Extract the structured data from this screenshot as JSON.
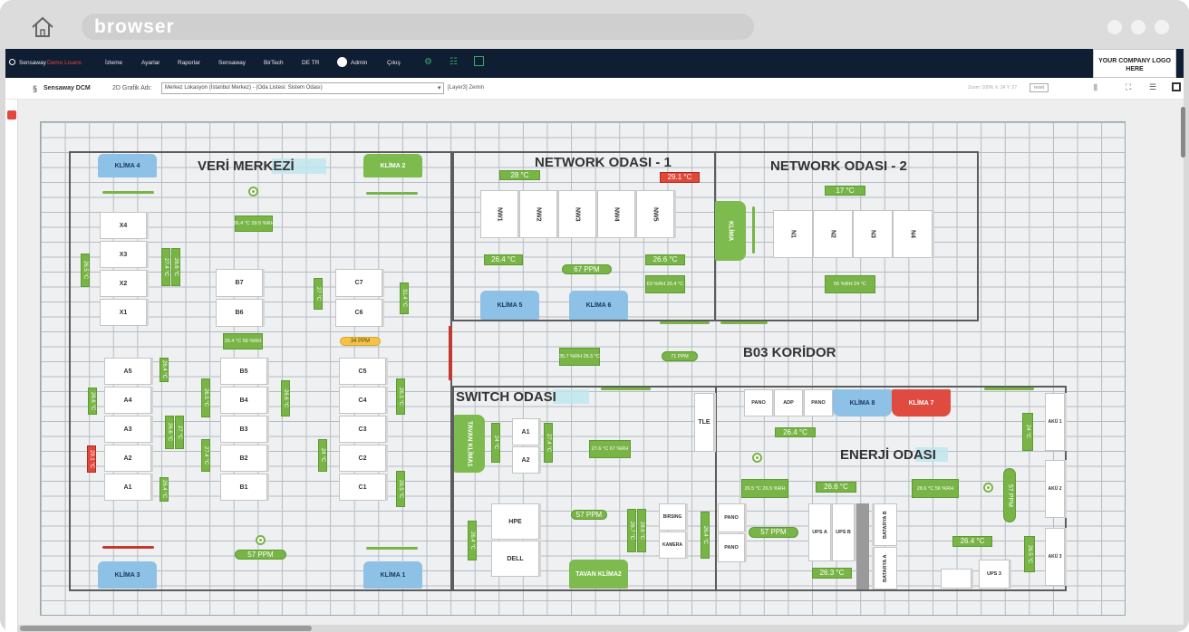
{
  "browser": {
    "url_text": "browser"
  },
  "nav": {
    "brand": "Sensaway",
    "brand_sub": "Demo Lisans",
    "items": [
      "İzleme",
      "Ayarlar",
      "Raporlar",
      "Sensaway",
      "BirTech",
      "DE TR"
    ],
    "user": "Admin",
    "logout": "Çıkış",
    "logo": "YOUR COMPANY LOGO HERE"
  },
  "subbar": {
    "app": "Sensaway DCM",
    "label": "2D Grafik Adı:",
    "location": "Merkez Lokasyon (İstanbul Merkez) - (Oda Listesi: Sistem Odası)",
    "layer": "[Layer3] Zemin",
    "zoom": "Zoom: 100% X: 24 Y: 27",
    "reset": "reset"
  },
  "rooms": {
    "veri": "VERİ MERKEZİ",
    "net1": "NETWORK ODASI - 1",
    "net2": "NETWORK ODASI - 2",
    "koridor": "B03 KORİDOR",
    "switch": "SWITCH ODASI",
    "enerji": "ENERJİ ODASI"
  },
  "racks": {
    "x4": "X4",
    "x3": "X3",
    "x2": "X2",
    "x1": "X1",
    "b7": "B7",
    "b6": "B6",
    "c7": "C7",
    "c6": "C6",
    "a5": "A5",
    "a4": "A4",
    "a3": "A3",
    "a2": "A2",
    "a1": "A1",
    "b5": "B5",
    "b4": "B4",
    "b3": "B3",
    "b2": "B2",
    "b1": "B1",
    "c5": "C5",
    "c4": "C4",
    "c3": "C3",
    "c2": "C2",
    "c1": "C1",
    "nw1": "NW1",
    "nw2": "NW2",
    "nw3": "NW3",
    "nw4": "NW4",
    "nw5": "NW5",
    "n1": "N1",
    "n2": "N2",
    "n3": "N3",
    "n4": "N4",
    "sa1": "A1",
    "sa2": "A2",
    "tle": "TLE",
    "hpe": "HPE",
    "dell": "DELL",
    "birsing": "BIRSING",
    "kamera": "KAMERA",
    "pano1": "PANO",
    "adp": "ADP",
    "pano2": "PANO",
    "pano3": "PANO",
    "pano4": "PANO",
    "upsa": "UPS A",
    "upsb": "UPS B",
    "batb": "BATARYA B",
    "bata": "BATARYA A",
    "ups3": "UPS 3",
    "aku1": "AKÜ 1",
    "aku2": "AKÜ 2",
    "aku3": "AKÜ 3"
  },
  "acs": {
    "k4": "KLİMA 4",
    "k2": "KLİMA 2",
    "k3": "KLİMA 3",
    "k1": "KLİMA 1",
    "k5": "KLİMA 5",
    "k6": "KLİMA 6",
    "kvert": "KLİMA",
    "k8": "KLİMA 8",
    "k7": "KLİMA 7",
    "tavan1": "TAVAN KLİMA1",
    "tavan2": "TAVAN KLİMA2"
  },
  "sensors": {
    "vm_center": "26.4 °C 39.5 %RH",
    "vm_mid": "26.4 °C 56 %RH",
    "vm_ppm_yellow": "34 PPM",
    "vm_ppm": "57 PPM",
    "n1_t1": "28 °C",
    "n1_t2": "29.1 °C",
    "n1_t3": "26.4 °C",
    "n1_ppm": "67 PPM",
    "n1_t4": "26.6 °C",
    "n1_rh": "63 %RH 26.4 °C",
    "n2_t1": "17 °C",
    "n2_rh": "56 %RH 24 °C",
    "kor_1": "35.7 %RH 26.5 °C",
    "kor_ppm": "71 PPM",
    "sw_1": "27.6 °C 67 %RH",
    "sw_ppm": "57 PPM",
    "en_t1": "26.4 °C",
    "en_1": "26.5 °C 26.5 %RH",
    "en_t2": "26.6 °C",
    "en_2": "28.6 °C 56 %RH",
    "en_ppm": "57 PPM",
    "en_t3": "26.4 °C",
    "en_t4": "26.3 °C",
    "v1": "26.5 °C",
    "v2": "27.4 °C",
    "v3": "26.6 °C",
    "v4": "27 °C",
    "v5": "31.4 °C",
    "v6": "26.4 °C",
    "v7": "26.6 °C",
    "v8": "29.1 °C",
    "v9": "26.6 °C",
    "v10": "27 °C",
    "v11": "26.4 °C",
    "v12": "26.5 °C",
    "v13": "27.4 °C",
    "v14": "26.6 °C",
    "v15": "24 °C",
    "v16": "26.5 °C",
    "v17": "24 °C",
    "v18": "27.4 °C",
    "v19": "57 PPM",
    "v20": "28.6 °C",
    "v21": "26.7 °C",
    "v22": "26.4 °C",
    "v23": "24 °C",
    "v24": "26.4 °C",
    "v25": "26.5 °C"
  },
  "colors": {
    "nav_bg": "#0f1e33",
    "sensor_green": "#78b446",
    "alarm_red": "#e0483b",
    "ac_blue": "#8ec1e6"
  }
}
